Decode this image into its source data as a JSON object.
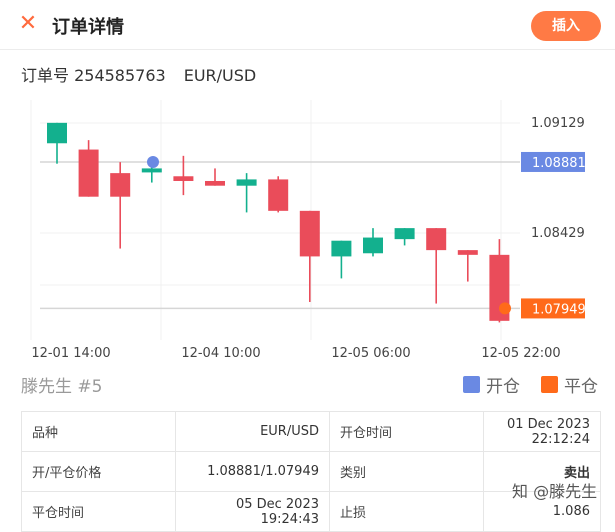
{
  "header": {
    "close_icon": "close-icon",
    "title": "订单详情",
    "insert_label": "插入"
  },
  "order": {
    "label": "订单号 254585763",
    "pair": "EUR/USD"
  },
  "legend": {
    "trader": "滕先生 #5",
    "open_label": "开仓",
    "close_label": "平仓"
  },
  "colors": {
    "up": "#13b08e",
    "down": "#ea4c5a",
    "open": "#6a89e3",
    "close": "#ff6a1a",
    "accent": "#ff7a45"
  },
  "table": {
    "rows": [
      {
        "l1": "品种",
        "v1": "EUR/USD",
        "l2": "开仓时间",
        "v2": "01 Dec 2023 22:12:24"
      },
      {
        "l1": "开/平仓价格",
        "v1": "1.08881/1.07949",
        "l2": "类别",
        "v2": "卖出"
      },
      {
        "l1": "平仓时间",
        "v1": "05 Dec 2023 19:24:43",
        "l2": "止损",
        "v2": "1.086"
      }
    ]
  },
  "watermark": "知 @滕先生",
  "chart_data": {
    "type": "candlestick",
    "yticks": [
      1.09129,
      1.08429
    ],
    "xticks": [
      "12-01 14:00",
      "12-04 10:00",
      "12-05 06:00",
      "12-05 22:00"
    ],
    "open_price": "1.08881",
    "close_price": "1.07949",
    "candles": [
      {
        "o": 1.09,
        "h": 1.0913,
        "c": 1.0913,
        "l": 1.0887
      },
      {
        "o": 1.0896,
        "h": 1.0902,
        "c": 1.0866,
        "l": 1.0866
      },
      {
        "o": 1.0881,
        "h": 1.0888,
        "c": 1.0866,
        "l": 1.0833
      },
      {
        "o": 1.0882,
        "h": 1.0886,
        "c": 1.0884,
        "l": 1.0875
      },
      {
        "o": 1.0879,
        "h": 1.0892,
        "c": 1.0876,
        "l": 1.0867
      },
      {
        "o": 1.0876,
        "h": 1.0884,
        "c": 1.0873,
        "l": 1.0873
      },
      {
        "o": 1.0873,
        "h": 1.0881,
        "c": 1.0877,
        "l": 1.0856
      },
      {
        "o": 1.0877,
        "h": 1.0879,
        "c": 1.0857,
        "l": 1.0856
      },
      {
        "o": 1.0857,
        "h": 1.0857,
        "c": 1.0828,
        "l": 1.0799
      },
      {
        "o": 1.0828,
        "h": 1.0838,
        "c": 1.0838,
        "l": 1.0814
      },
      {
        "o": 1.083,
        "h": 1.0846,
        "c": 1.084,
        "l": 1.0828
      },
      {
        "o": 1.0839,
        "h": 1.0846,
        "c": 1.0846,
        "l": 1.0835
      },
      {
        "o": 1.0846,
        "h": 1.0846,
        "c": 1.0832,
        "l": 1.0798
      },
      {
        "o": 1.0832,
        "h": 1.0832,
        "c": 1.0829,
        "l": 1.0812
      },
      {
        "o": 1.0829,
        "h": 1.0839,
        "c": 1.0787,
        "l": 1.0786
      }
    ]
  }
}
